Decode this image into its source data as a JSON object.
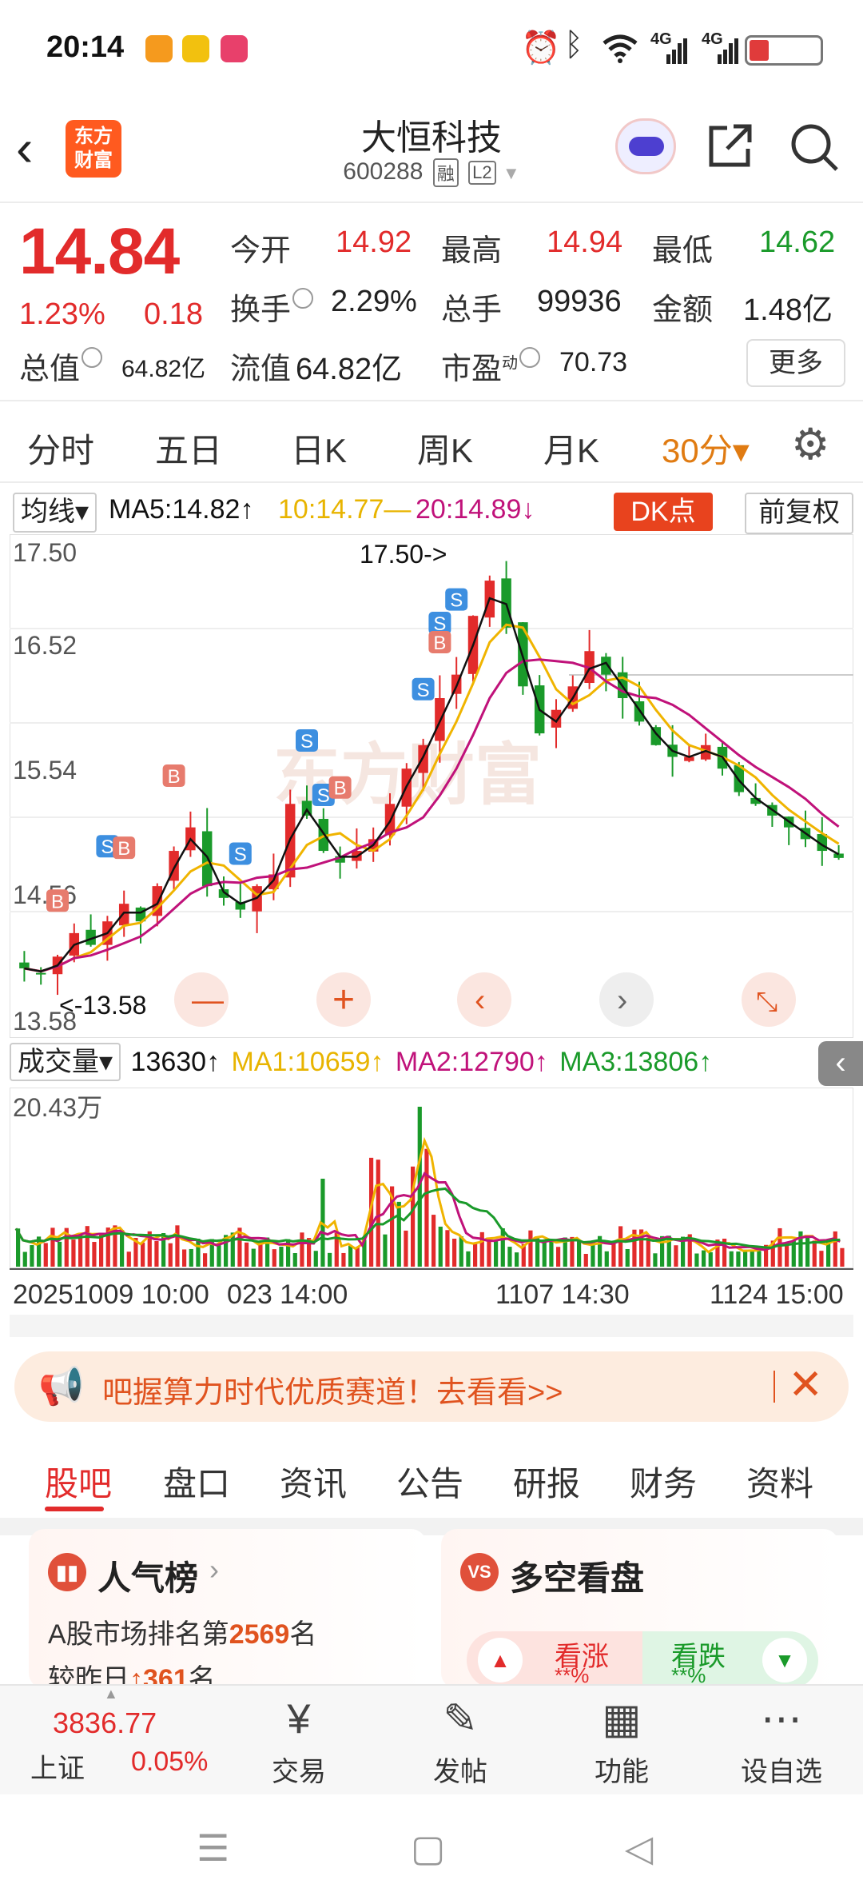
{
  "status_bar": {
    "time": "20:14",
    "battery": "17",
    "net1": "4G",
    "net2": "4G"
  },
  "header": {
    "back_icon": "chevron-left",
    "logo_text": "东方财富",
    "stock_name": "大恒科技",
    "stock_code": "600288",
    "tag_rong": "融",
    "tag_l2": "L2"
  },
  "quote": {
    "price": "14.84",
    "change_pct": "1.23%",
    "change_abs": "0.18",
    "fields": {
      "open_label": "今开",
      "open": "14.92",
      "high_label": "最高",
      "high": "14.94",
      "low_label": "最低",
      "low": "14.62",
      "turnover_label": "换手",
      "turnover": "2.29%",
      "volume_label": "总手",
      "volume": "99936",
      "amount_label": "金额",
      "amount": "1.48亿",
      "mktcap_label": "总值",
      "mktcap": "64.82亿",
      "float_label": "流值",
      "float": "64.82亿",
      "pe_label": "市盈",
      "pe_sup": "动",
      "pe": "70.73"
    },
    "more_button": "更多"
  },
  "period_tabs": [
    "分时",
    "五日",
    "日K",
    "周K",
    "月K",
    "30分▾"
  ],
  "period_active_index": 5,
  "chart_header": {
    "ma_select": "均线▾",
    "ma5": "MA5:14.82↑",
    "ma10": "10:14.77—",
    "ma20": "20:14.89↓",
    "dk_button": "DK点",
    "fq_button": "前复权"
  },
  "chart_labels": {
    "y_ticks": [
      "17.50",
      "16.52",
      "15.54",
      "14.56",
      "13.58"
    ],
    "high_annotation": "17.50->",
    "low_annotation": "<-13.58",
    "watermark": "东方财富"
  },
  "volume_header": {
    "select": "成交量▾",
    "vol": "13630↑",
    "ma1": "MA1:10659↑",
    "ma2": "MA2:12790↑",
    "ma3": "MA3:13806↑",
    "vol_top": "20.43万"
  },
  "x_axis": {
    "t1": "20251009 10:00",
    "t2": "023 14:00",
    "t3": "1107 14:30",
    "t4": "1124 15:00"
  },
  "banner": {
    "text": "吧握算力时代优质赛道！去看看>>"
  },
  "content_tabs": [
    "股吧",
    "盘口",
    "资讯",
    "公告",
    "研报",
    "财务",
    "资料"
  ],
  "cards": {
    "popularity": {
      "title": "人气榜",
      "line1_pre": "A股市场排名第",
      "line1_num": "2569",
      "line1_post": "名",
      "line2_pre": "较昨日",
      "line2_num": "↑361",
      "line2_post": "名"
    },
    "longshort": {
      "title": "多空看盘",
      "bull_label": "看涨",
      "bull_val": "**%",
      "bear_label": "看跌",
      "bear_val": "**%"
    }
  },
  "bottom_nav": {
    "index_value": "3836.77",
    "index_name": "上证",
    "index_change": "0.05%",
    "items": [
      "交易",
      "发帖",
      "功能",
      "设自选"
    ]
  },
  "colors": {
    "up": "#e22b2b",
    "down": "#1a9a2a",
    "ma5": "#111111",
    "ma10": "#f0b400",
    "ma20": "#c0127a",
    "accent": "#e07b12"
  },
  "chart_data": {
    "type": "candlestick",
    "interval": "30分",
    "y_range": [
      13.58,
      17.5
    ],
    "close_approx": [
      13.9,
      13.85,
      14.0,
      14.2,
      14.1,
      14.3,
      14.45,
      14.3,
      14.6,
      14.9,
      15.1,
      14.6,
      14.5,
      14.4,
      14.6,
      14.7,
      15.3,
      15.2,
      14.9,
      14.8,
      14.9,
      15.0,
      15.3,
      15.6,
      15.8,
      16.2,
      16.4,
      16.9,
      17.2,
      16.8,
      16.3,
      15.9,
      16.1,
      16.3,
      16.6,
      16.4,
      16.2,
      16.0,
      15.8,
      15.7,
      15.7,
      15.8,
      15.6,
      15.4,
      15.3,
      15.2,
      15.1,
      15.0,
      14.9,
      14.84
    ],
    "volume_max": "20.43万"
  }
}
